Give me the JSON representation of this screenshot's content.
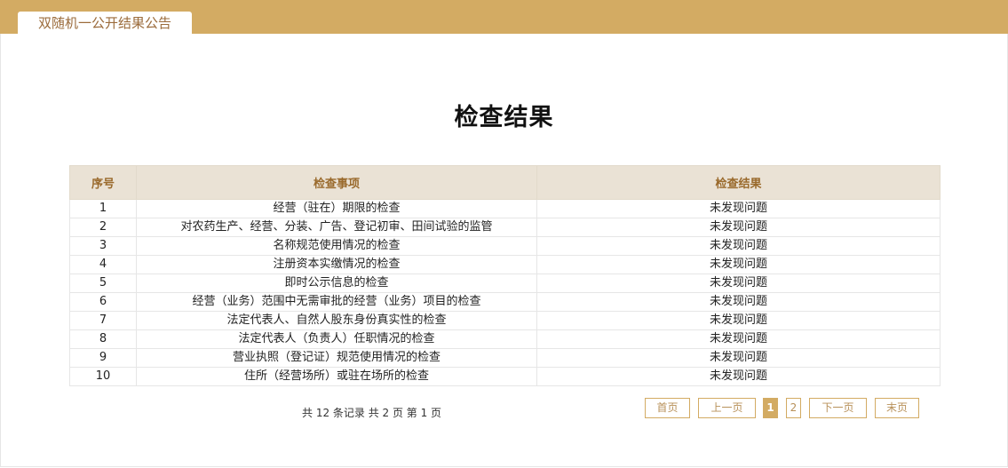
{
  "tab": {
    "label": "双随机一公开结果公告"
  },
  "page_title": "检查结果",
  "table": {
    "headers": [
      "序号",
      "检查事项",
      "检查结果"
    ],
    "rows": [
      [
        "1",
        "经营（驻在）期限的检查",
        "未发现问题"
      ],
      [
        "2",
        "对农药生产、经营、分装、广告、登记初审、田间试验的监管",
        "未发现问题"
      ],
      [
        "3",
        "名称规范使用情况的检查",
        "未发现问题"
      ],
      [
        "4",
        "注册资本实缴情况的检查",
        "未发现问题"
      ],
      [
        "5",
        "即时公示信息的检查",
        "未发现问题"
      ],
      [
        "6",
        "经营（业务）范围中无需审批的经营（业务）项目的检查",
        "未发现问题"
      ],
      [
        "7",
        "法定代表人、自然人股东身份真实性的检查",
        "未发现问题"
      ],
      [
        "8",
        "法定代表人（负责人）任职情况的检查",
        "未发现问题"
      ],
      [
        "9",
        "营业执照（登记证）规范使用情况的检查",
        "未发现问题"
      ],
      [
        "10",
        "住所（经营场所）或驻在场所的检查",
        "未发现问题"
      ]
    ]
  },
  "pagination": {
    "info": "共 12 条记录 共 2 页 第 1 页",
    "first": "首页",
    "prev": "上一页",
    "pages": [
      "1",
      "2"
    ],
    "current_page": "1",
    "next": "下一页",
    "last": "末页"
  },
  "colors": {
    "accent": "#d3ab63",
    "header_bg": "#eae2d5",
    "header_text": "#9a6a2c"
  }
}
